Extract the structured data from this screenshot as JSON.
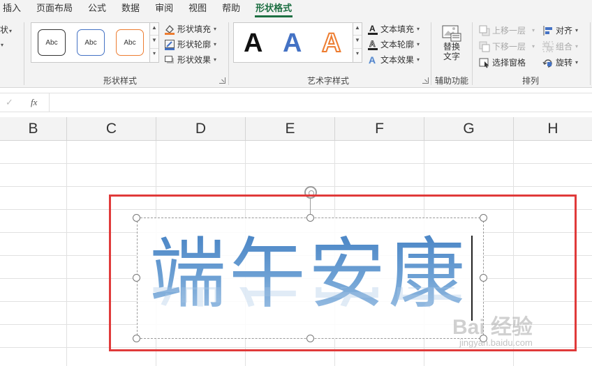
{
  "ribbon_tabs": [
    {
      "label": "插入"
    },
    {
      "label": "页面布局"
    },
    {
      "label": "公式"
    },
    {
      "label": "数据"
    },
    {
      "label": "审阅"
    },
    {
      "label": "视图"
    },
    {
      "label": "帮助"
    },
    {
      "label": "形状格式",
      "active": true
    }
  ],
  "left_stub": {
    "top_label": "状",
    "bottom_label": "·"
  },
  "shape_styles": {
    "group_label": "形状样式",
    "presets": [
      {
        "label": "Abc",
        "border_color": "#333333"
      },
      {
        "label": "Abc",
        "border_color": "#4472c4"
      },
      {
        "label": "Abc",
        "border_color": "#ed7d31"
      }
    ],
    "fill_label": "形状填充",
    "outline_label": "形状轮廓",
    "effect_label": "形状效果"
  },
  "wordart_styles": {
    "group_label": "艺术字样式",
    "presets": [
      {
        "label": "A",
        "color": "#111111"
      },
      {
        "label": "A",
        "color": "#4472c4"
      },
      {
        "label": "A",
        "color": "#ed7d31"
      }
    ],
    "text_fill_label": "文本填充",
    "text_outline_label": "文本轮廓",
    "text_effect_label": "文本效果"
  },
  "accessibility": {
    "group_label": "辅助功能",
    "alt_text_line1": "替换",
    "alt_text_line2": "文字"
  },
  "arrange": {
    "group_label": "排列",
    "bring_forward_label": "上移一层",
    "send_backward_label": "下移一层",
    "selection_pane_label": "选择窗格",
    "align_label": "对齐",
    "group_obj_label": "组合",
    "rotate_label": "旋转"
  },
  "formula_bar": {
    "check": "✓",
    "fx": "fx",
    "value": ""
  },
  "columns": [
    "B",
    "C",
    "D",
    "E",
    "F",
    "G",
    "H"
  ],
  "wordart_text": "端午安康",
  "watermark": {
    "logo": "Bai 经验",
    "url": "jingyan.baidu.com"
  },
  "colors": {
    "active_tab": "#1d6f42",
    "highlight_box": "#e03a3a"
  }
}
